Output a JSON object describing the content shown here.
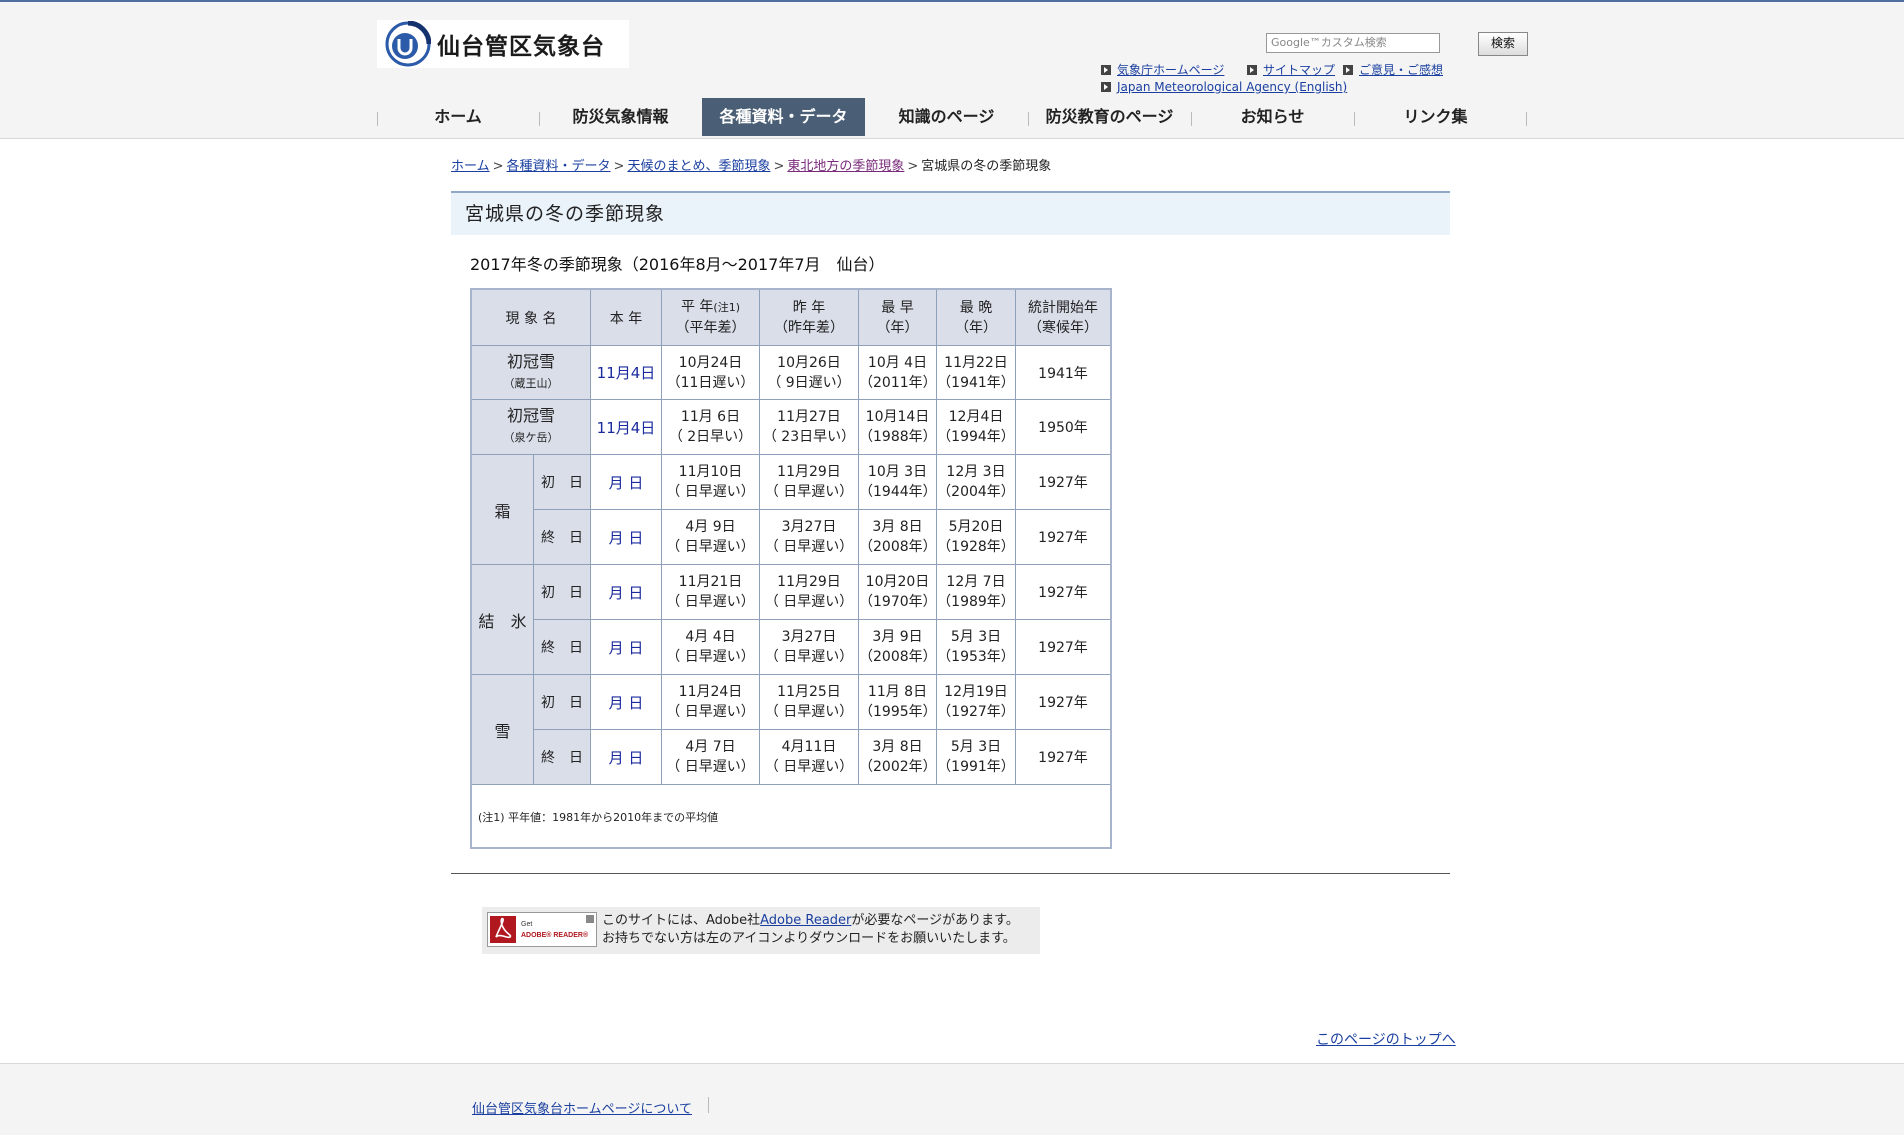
{
  "site": {
    "title": "仙台管区気象台"
  },
  "search": {
    "placeholder": "Google™カスタム検索",
    "button": "検索"
  },
  "util_links": [
    "気象庁ホームページ",
    "サイトマップ",
    "ご意見・ご感想",
    "Japan Meteorological Agency (English)"
  ],
  "nav": [
    "ホーム",
    "防災気象情報",
    "各種資料・データ",
    "知識のページ",
    "防災教育のページ",
    "お知らせ",
    "リンク集"
  ],
  "nav_active": "各種資料・データ",
  "breadcrumb": {
    "links": [
      "ホーム",
      "各種資料・データ",
      "天候のまとめ、季節現象",
      "東北地方の季節現象"
    ],
    "separator": ">",
    "current": "宮城県の冬の季節現象"
  },
  "page_title": "宮城県の冬の季節現象",
  "subtitle": "2017年冬の季節現象（2016年8月～2017年7月　仙台）",
  "table": {
    "headers": {
      "name": "現 象 名",
      "this_year": "本 年",
      "normal": "平 年",
      "normal_note": "(注1)",
      "normal_sub": "（平年差）",
      "last_year": "昨 年",
      "last_year_sub": "（昨年差）",
      "earliest": "最 早",
      "earliest_sub": "（年）",
      "latest": "最 晩",
      "latest_sub": "（年）",
      "start": "統計開始年",
      "start_sub": "（寒候年）"
    },
    "rows": [
      {
        "name": "初冠雪",
        "sub": "（蔵王山）",
        "this_year": "11月4日",
        "normal": "10月24日",
        "normal_diff": "（11日遅い）",
        "last": "10月26日",
        "last_diff": "（ 9日遅い）",
        "earliest": "10月 4日",
        "earliest_yr": "（2011年）",
        "latest": "11月22日",
        "latest_yr": "（1941年）",
        "start": "1941年"
      },
      {
        "name": "初冠雪",
        "sub": "（泉ケ岳）",
        "this_year": "11月4日",
        "normal": "11月 6日",
        "normal_diff": "（ 2日早い）",
        "last": "11月27日",
        "last_diff": "（ 23日早い）",
        "earliest": "10月14日",
        "earliest_yr": "（1988年）",
        "latest": "12月4日",
        "latest_yr": "（1994年）",
        "start": "1950年"
      }
    ],
    "groups": [
      {
        "name": "霜",
        "rows": [
          {
            "label": "初　日",
            "this_year": "月 日",
            "normal": "11月10日",
            "normal_diff": "（ 日早遅い）",
            "last": "11月29日",
            "last_diff": "（ 日早遅い）",
            "earliest": "10月 3日",
            "earliest_yr": "（1944年）",
            "latest": "12月 3日",
            "latest_yr": "（2004年）",
            "start": "1927年"
          },
          {
            "label": "終　日",
            "this_year": "月 日",
            "normal": "4月 9日",
            "normal_diff": "（ 日早遅い）",
            "last": "3月27日",
            "last_diff": "（ 日早遅い）",
            "earliest": "3月 8日",
            "earliest_yr": "（2008年）",
            "latest": "5月20日",
            "latest_yr": "（1928年）",
            "start": "1927年"
          }
        ]
      },
      {
        "name": "結　氷",
        "rows": [
          {
            "label": "初　日",
            "this_year": "月 日",
            "normal": "11月21日",
            "normal_diff": "（ 日早遅い）",
            "last": "11月29日",
            "last_diff": "（ 日早遅い）",
            "earliest": "10月20日",
            "earliest_yr": "（1970年）",
            "latest": "12月 7日",
            "latest_yr": "（1989年）",
            "start": "1927年"
          },
          {
            "label": "終　日",
            "this_year": "月 日",
            "normal": "4月 4日",
            "normal_diff": "（ 日早遅い）",
            "last": "3月27日",
            "last_diff": "（ 日早遅い）",
            "earliest": "3月 9日",
            "earliest_yr": "（2008年）",
            "latest": "5月 3日",
            "latest_yr": "（1953年）",
            "start": "1927年"
          }
        ]
      },
      {
        "name": "雪",
        "rows": [
          {
            "label": "初　日",
            "this_year": "月 日",
            "normal": "11月24日",
            "normal_diff": "（ 日早遅い）",
            "last": "11月25日",
            "last_diff": "（ 日早遅い）",
            "earliest": "11月 8日",
            "earliest_yr": "（1995年）",
            "latest": "12月19日",
            "latest_yr": "（1927年）",
            "start": "1927年"
          },
          {
            "label": "終　日",
            "this_year": "月 日",
            "normal": "4月 7日",
            "normal_diff": "（ 日早遅い）",
            "last": "4月11日",
            "last_diff": "（ 日早遅い）",
            "earliest": "3月 8日",
            "earliest_yr": "（2002年）",
            "latest": "5月 3日",
            "latest_yr": "（1991年）",
            "start": "1927年"
          }
        ]
      }
    ],
    "note": "(注1) 平年値：1981年から2010年までの平均値"
  },
  "adobe": {
    "icon_text": "Get ADOBE® READER®",
    "line1_pre": "このサイトには、Adobe社",
    "line1_link": "Adobe Reader",
    "line1_post": "が必要なページがあります。",
    "line2": "お持ちでない方は左のアイコンよりダウンロードをお願いいたします。"
  },
  "to_top": "このページのトップへ",
  "footer": {
    "link": "仙台管区気象台ホームページについて"
  },
  "colors": {
    "nav_active_bg": "#4a5e75",
    "link": "#1a3fa0",
    "table_header": "#d9dee9",
    "table_border": "#8fa0bb",
    "title_bg": "#eaf2fa"
  },
  "icons": [
    "logo-icon",
    "bullet-arrow-icon",
    "adobe-reader-icon"
  ]
}
